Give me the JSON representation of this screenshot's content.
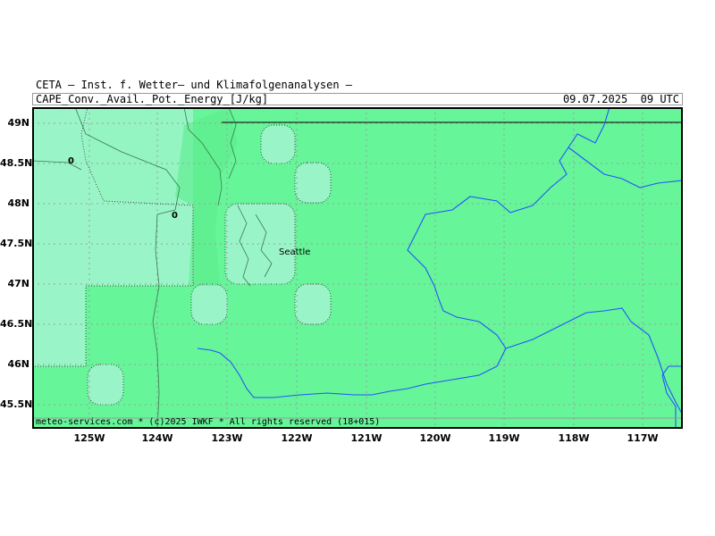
{
  "header": {
    "institute": "CETA — Inst. f. Wetter— und Klimafolgenanalysen —"
  },
  "title_bar": {
    "parameter": "CAPE_Conv._Avail._Pot._Energy_[J/kg]",
    "valid_time": "09.07.2025  09 UTC"
  },
  "map": {
    "latitude_labels": [
      "49N",
      "48.5N",
      "48N",
      "47.5N",
      "47N",
      "46.5N",
      "46N",
      "45.5N"
    ],
    "longitude_labels": [
      "125W",
      "124W",
      "123W",
      "122W",
      "121W",
      "120W",
      "119W",
      "118W",
      "117W"
    ],
    "city_label": "Seattle",
    "contour_labels": [
      "0",
      "0"
    ],
    "colors": {
      "field_green": "#66f599",
      "field_light": "#99f5c8",
      "coast_green": "#5ced8c",
      "river_blue": "#2255ff",
      "border_black": "#000000",
      "grid_gray": "#a0a0a0"
    }
  },
  "footer": {
    "copyright": "meteo-services.com * (c)2025 IWKF * All rights reserved (18+015)"
  }
}
